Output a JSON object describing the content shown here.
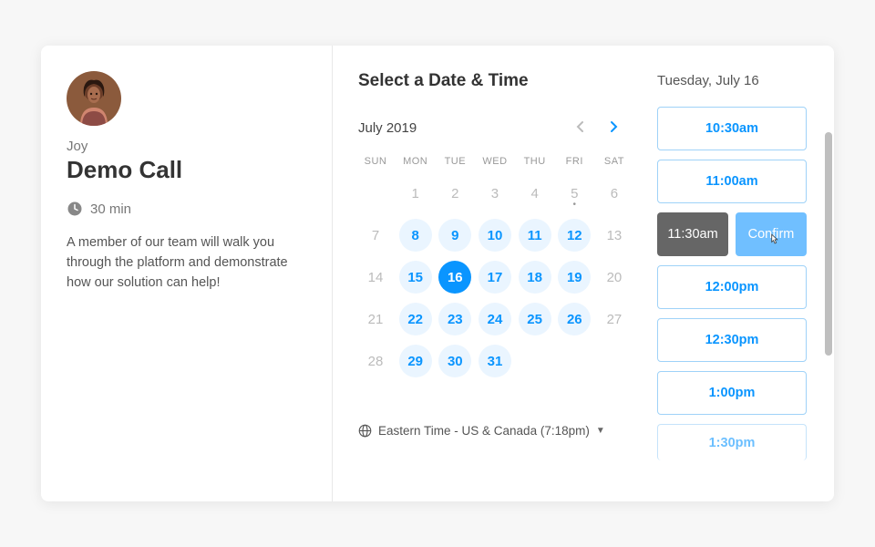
{
  "event": {
    "host": "Joy",
    "title": "Demo Call",
    "duration": "30 min",
    "description": "A member of our team will walk you through the platform and demonstrate how our solution can help!"
  },
  "section_title": "Select a Date & Time",
  "calendar": {
    "month_label": "July 2019",
    "dow": [
      "SUN",
      "MON",
      "TUE",
      "WED",
      "THU",
      "FRI",
      "SAT"
    ],
    "weeks": [
      [
        {
          "n": ""
        },
        {
          "n": "1"
        },
        {
          "n": "2"
        },
        {
          "n": "3"
        },
        {
          "n": "4"
        },
        {
          "n": "5",
          "dot": true
        },
        {
          "n": "6"
        }
      ],
      [
        {
          "n": "7"
        },
        {
          "n": "8",
          "a": true
        },
        {
          "n": "9",
          "a": true
        },
        {
          "n": "10",
          "a": true
        },
        {
          "n": "11",
          "a": true
        },
        {
          "n": "12",
          "a": true
        },
        {
          "n": "13"
        }
      ],
      [
        {
          "n": "14"
        },
        {
          "n": "15",
          "a": true
        },
        {
          "n": "16",
          "a": true,
          "s": true
        },
        {
          "n": "17",
          "a": true
        },
        {
          "n": "18",
          "a": true
        },
        {
          "n": "19",
          "a": true
        },
        {
          "n": "20"
        }
      ],
      [
        {
          "n": "21"
        },
        {
          "n": "22",
          "a": true
        },
        {
          "n": "23",
          "a": true
        },
        {
          "n": "24",
          "a": true
        },
        {
          "n": "25",
          "a": true
        },
        {
          "n": "26",
          "a": true
        },
        {
          "n": "27"
        }
      ],
      [
        {
          "n": "28"
        },
        {
          "n": "29",
          "a": true
        },
        {
          "n": "30",
          "a": true
        },
        {
          "n": "31",
          "a": true
        },
        {
          "n": ""
        },
        {
          "n": ""
        },
        {
          "n": ""
        }
      ]
    ]
  },
  "timezone": "Eastern Time - US & Canada (7:18pm)",
  "selected_date": "Tuesday, July 16",
  "slots": {
    "list": [
      "10:30am",
      "11:00am"
    ],
    "selected": "11:30am",
    "confirm_label": "Confirm",
    "after": [
      "12:00pm",
      "12:30pm",
      "1:00pm"
    ],
    "partial": "1:30pm"
  }
}
